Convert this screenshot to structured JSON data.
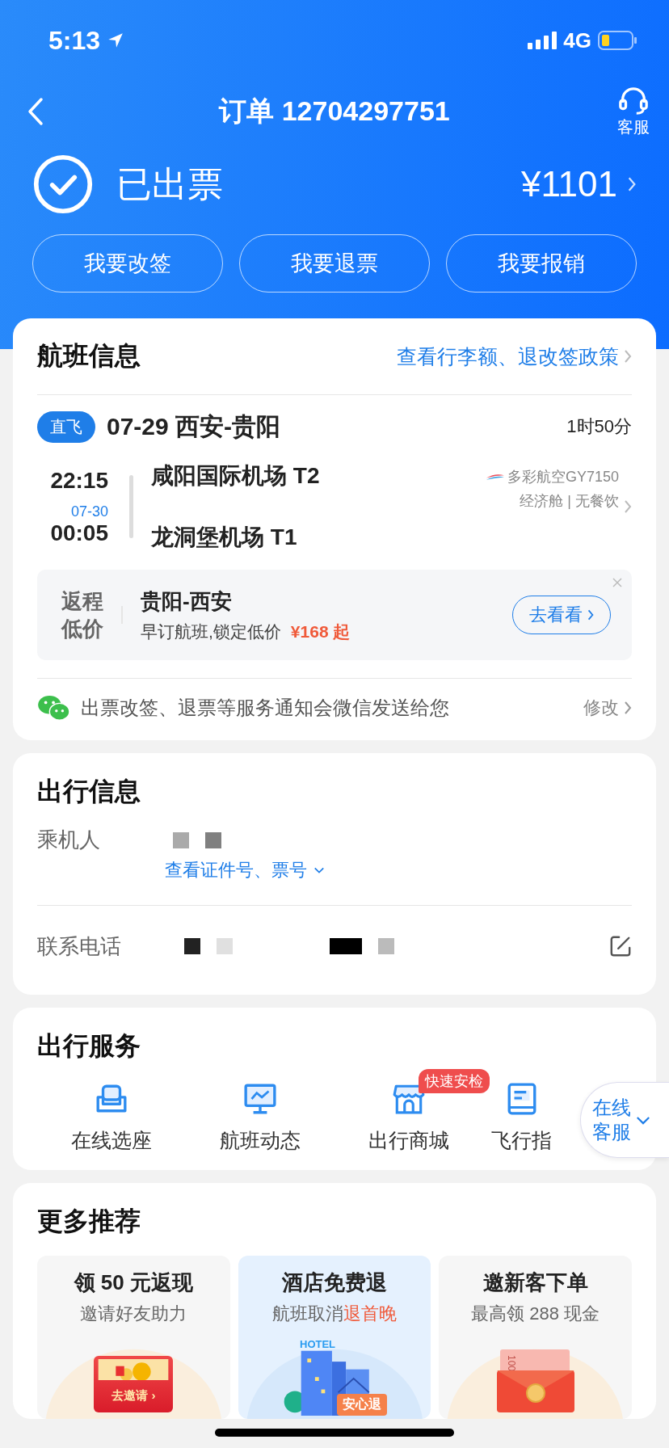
{
  "status_bar": {
    "time": "5:13",
    "network": "4G"
  },
  "nav": {
    "title": "订单 12704297751",
    "service_label": "客服"
  },
  "order": {
    "status": "已出票",
    "price": "¥1101"
  },
  "actions": [
    "我要改签",
    "我要退票",
    "我要报销"
  ],
  "flight_info": {
    "title": "航班信息",
    "policy_link": "查看行李额、退改签政策",
    "tag": "直飞",
    "route": "07-29 西安-贵阳",
    "duration": "1时50分",
    "depart": {
      "time": "22:15",
      "airport": "咸阳国际机场 T2"
    },
    "arrive": {
      "date": "07-30",
      "time": "00:05",
      "airport": "龙洞堡机场 T1"
    },
    "airline": "多彩航空GY7150",
    "cabin": "经济舱 | 无餐饮",
    "return_promo": {
      "badge_line1": "返程",
      "badge_line2": "低价",
      "route": "贵阳-西安",
      "text": "早订航班,锁定低价",
      "price": "¥168 起",
      "button": "去看看"
    },
    "notice": {
      "text": "出票改签、退票等服务通知会微信发送给您",
      "action": "修改"
    }
  },
  "trip_info": {
    "title": "出行信息",
    "passenger_label": "乘机人",
    "id_link": "查看证件号、票号",
    "phone_label": "联系电话"
  },
  "services": {
    "title": "出行服务",
    "items": [
      {
        "kind": "seat",
        "label": "在线选座"
      },
      {
        "kind": "monitor",
        "label": "航班动态"
      },
      {
        "kind": "shop",
        "label": "出行商城",
        "badge": "快速安检"
      },
      {
        "kind": "book",
        "label": "飞行指"
      }
    ]
  },
  "floating_service": {
    "line1": "在线",
    "line2": "客服"
  },
  "recommend": {
    "title": "更多推荐",
    "cards": [
      {
        "kind": "invite",
        "title": "领 50 元返现",
        "subtitle": "邀请好友助力",
        "art_label": "去邀请 ›"
      },
      {
        "kind": "hotel",
        "title": "酒店免费退",
        "subtitle": "航班取消",
        "highlight": "退首晚",
        "art_top": "HOTEL",
        "art_label": "安心退"
      },
      {
        "kind": "cash",
        "title": "邀新客下单",
        "subtitle": "最高领 288 现金",
        "art_label": "100"
      }
    ]
  }
}
